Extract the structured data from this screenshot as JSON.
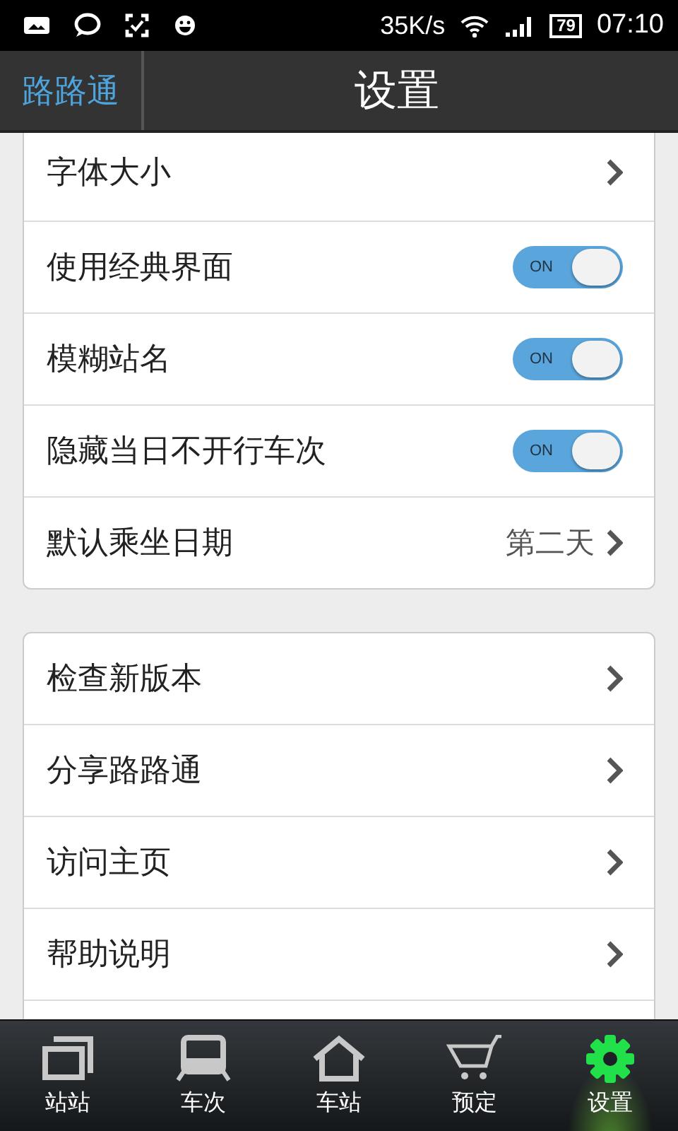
{
  "status_bar": {
    "network_speed": "35K/s",
    "battery": "79",
    "time": "07:10"
  },
  "header": {
    "back_label": "路路通",
    "title": "设置"
  },
  "groups": [
    {
      "items": [
        {
          "kind": "link",
          "label": "字体大小"
        },
        {
          "kind": "toggle",
          "label": "使用经典界面",
          "on": true,
          "state_label": "ON"
        },
        {
          "kind": "toggle",
          "label": "模糊站名",
          "on": true,
          "state_label": "ON"
        },
        {
          "kind": "toggle",
          "label": "隐藏当日不开行车次",
          "on": true,
          "state_label": "ON"
        },
        {
          "kind": "value",
          "label": "默认乘坐日期",
          "value": "第二天"
        }
      ]
    },
    {
      "items": [
        {
          "kind": "link",
          "label": "检查新版本"
        },
        {
          "kind": "link",
          "label": "分享路路通"
        },
        {
          "kind": "link",
          "label": "访问主页"
        },
        {
          "kind": "link",
          "label": "帮助说明"
        }
      ]
    }
  ],
  "tabs": [
    {
      "label": "站站",
      "selected": false
    },
    {
      "label": "车次",
      "selected": false
    },
    {
      "label": "车站",
      "selected": false
    },
    {
      "label": "预定",
      "selected": false
    },
    {
      "label": "设置",
      "selected": true
    }
  ]
}
